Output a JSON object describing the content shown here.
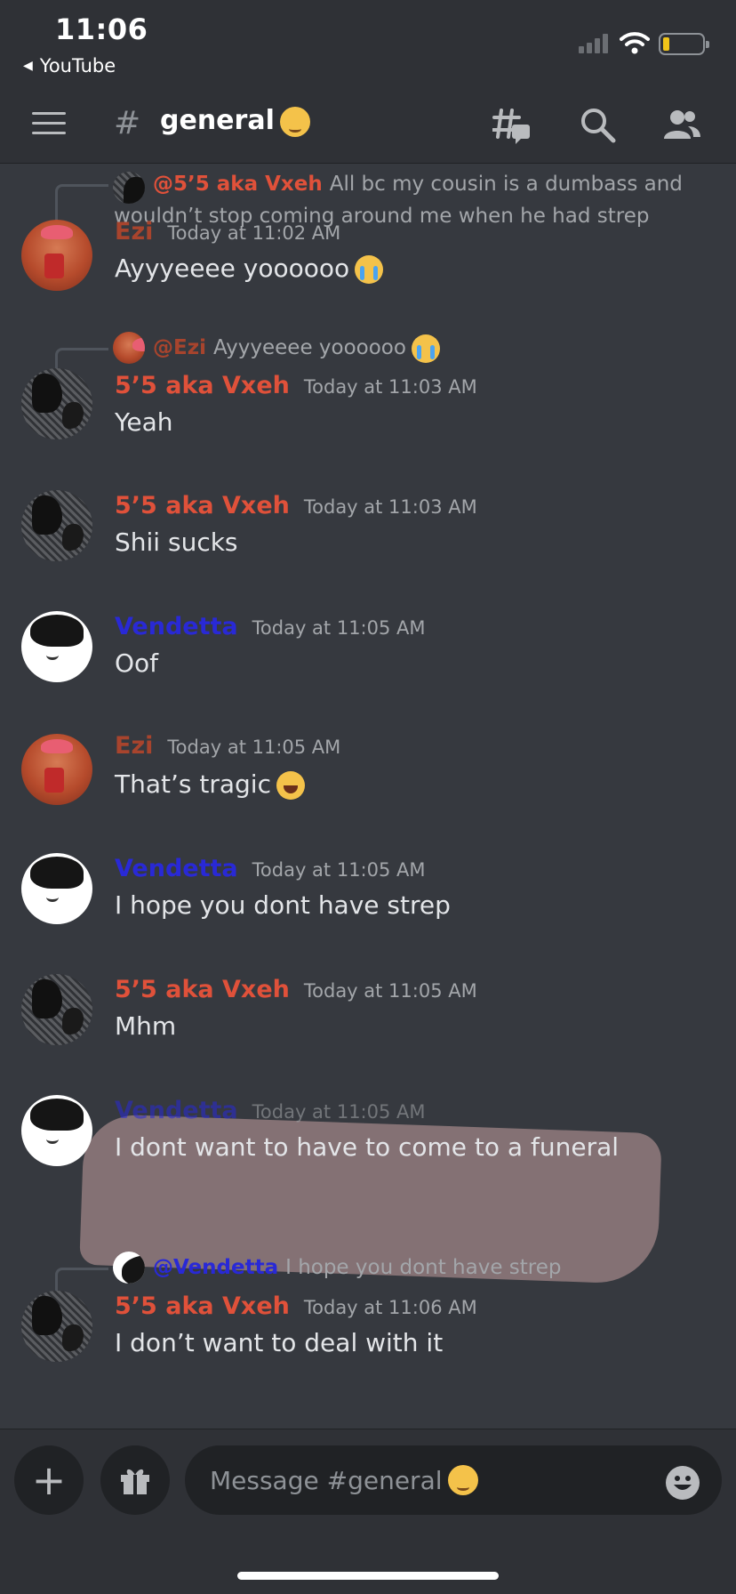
{
  "status_bar": {
    "time": "11:06",
    "back_app": "YouTube"
  },
  "header": {
    "channel": "general"
  },
  "messages": [
    {
      "type": "reply_preview",
      "reply_to": "@5’5 aka Vxeh",
      "reply_text": "All bc my cousin is a dumbass and wouldn’t stop coming around me when he had strep"
    },
    {
      "author": "Ezi",
      "timestamp": "Today at 11:02 AM",
      "text": "Ayyyeeee yoooooo"
    },
    {
      "author": "5’5 aka Vxeh",
      "timestamp": "Today at 11:03 AM",
      "text": "Yeah",
      "reply_to": "@Ezi",
      "reply_text": "Ayyyeeee yoooooo"
    },
    {
      "author": "5’5 aka Vxeh",
      "timestamp": "Today at 11:03 AM",
      "text": "Shii sucks"
    },
    {
      "author": "Vendetta",
      "timestamp": "Today at 11:05 AM",
      "text": "Oof"
    },
    {
      "author": "Ezi",
      "timestamp": "Today at 11:05 AM",
      "text": "That’s tragic"
    },
    {
      "author": "Vendetta",
      "timestamp": "Today at 11:05 AM",
      "text": "I hope you dont have strep"
    },
    {
      "author": "5’5 aka Vxeh",
      "timestamp": "Today at 11:05 AM",
      "text": "Mhm"
    },
    {
      "author": "Vendetta",
      "timestamp": "Today at 11:05 AM",
      "text": "I dont want to have to come to a funeral"
    },
    {
      "author": "5’5 aka Vxeh",
      "timestamp": "Today at 11:06 AM",
      "text": "I don’t want to deal with it",
      "reply_to": "@Vendetta",
      "reply_text": "I hope you dont have strep"
    }
  ],
  "composer": {
    "placeholder": "Message #general"
  },
  "colors": {
    "ezi": "#a8442d",
    "vxeh": "#e0513a",
    "vendetta": "#2929d6",
    "background": "#36393f",
    "header_bg": "#2f3136"
  },
  "icons": [
    "hamburger-icon",
    "threads-icon",
    "search-icon",
    "members-icon",
    "plus-icon",
    "gift-icon",
    "emoji-icon"
  ]
}
